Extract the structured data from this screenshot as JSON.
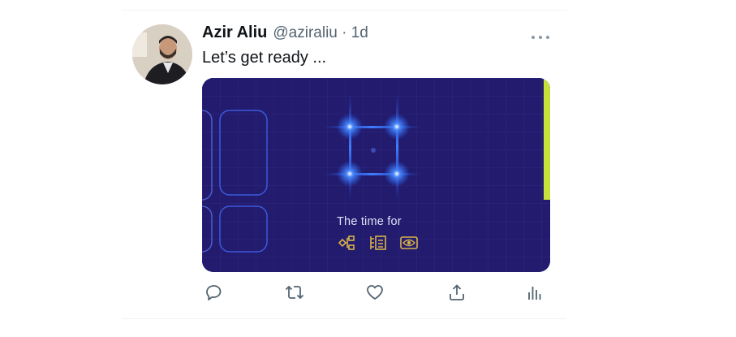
{
  "tweet": {
    "author_name": "Azir Aliu",
    "author_meta": "@aziraliu · 1d",
    "text": "Let’s get ready ...",
    "media_caption": "The time for"
  },
  "icons": {
    "more": "more-horizontal-icon",
    "reply": "reply-icon",
    "retweet": "retweet-icon",
    "like": "heart-icon",
    "share": "share-icon",
    "analytics": "analytics-icon",
    "media_icons": [
      "workflow-icon",
      "checklist-icon",
      "eye-icon"
    ]
  },
  "colors": {
    "card_bg": "#221b6e",
    "accent_glow": "#2b6bff",
    "accent_lime": "#c8e03a",
    "icon_gold": "#d9b24a"
  }
}
